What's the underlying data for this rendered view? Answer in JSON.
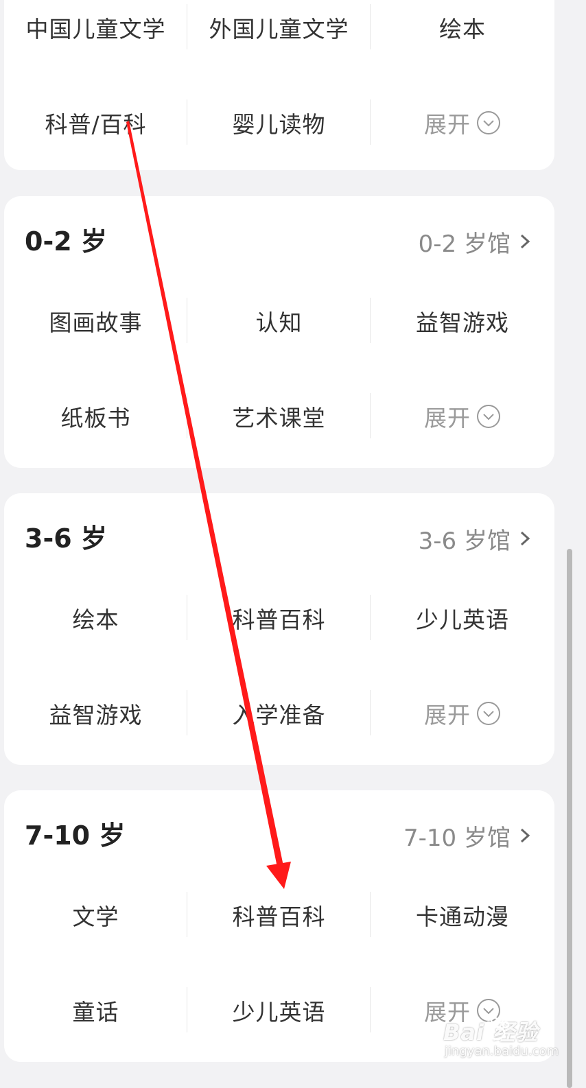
{
  "top_card": {
    "rows": [
      [
        "中国儿童文学",
        "外国儿童文学",
        "绘本"
      ],
      [
        "科普/百科",
        "婴儿读物",
        "展开"
      ]
    ]
  },
  "sections": [
    {
      "title": "0-2 岁",
      "link": "0-2 岁馆",
      "rows": [
        [
          "图画故事",
          "认知",
          "益智游戏"
        ],
        [
          "纸板书",
          "艺术课堂",
          "展开"
        ]
      ]
    },
    {
      "title": "3-6 岁",
      "link": "3-6 岁馆",
      "rows": [
        [
          "绘本",
          "科普百科",
          "少儿英语"
        ],
        [
          "益智游戏",
          "入学准备",
          "展开"
        ]
      ]
    },
    {
      "title": "7-10 岁",
      "link": "7-10 岁馆",
      "rows": [
        [
          "文学",
          "科普百科",
          "卡通动漫"
        ],
        [
          "童话",
          "少儿英语",
          "展开"
        ]
      ]
    }
  ],
  "icons": {
    "expand": "chevron-down-circle-icon",
    "link": "chevron-right-icon",
    "annotation": "red-arrow",
    "watermark_logo": "baidu-paw-logo"
  },
  "watermark": {
    "main": "Bai  经验",
    "sub": "jingyan.baidu.com"
  },
  "colors": {
    "background": "#f2f2f4",
    "card": "#ffffff",
    "text": "#333333",
    "muted": "#9a9a9a",
    "annotation_red": "#ff1a1a"
  }
}
